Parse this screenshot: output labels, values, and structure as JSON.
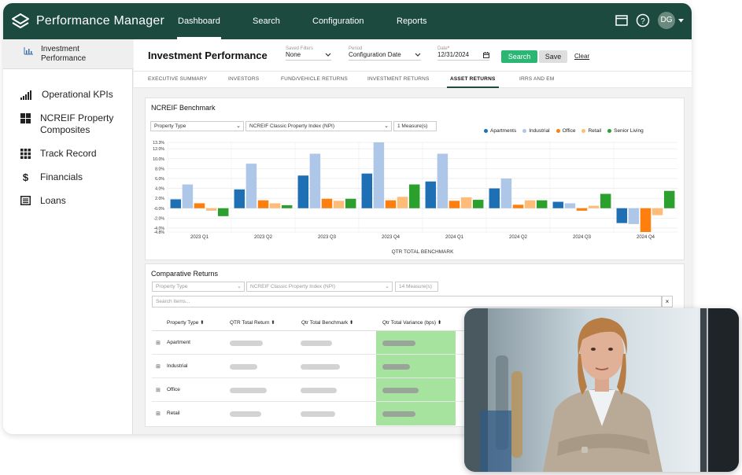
{
  "app": {
    "brand": "Performance Manager",
    "avatar_initials": "DG"
  },
  "nav": [
    "Dashboard",
    "Search",
    "Configuration",
    "Reports"
  ],
  "sidebar": {
    "active": "Investment Performance",
    "items": [
      "Operational KPIs",
      "NCREIF Property Composites",
      "Track Record",
      "Financials",
      "Loans"
    ]
  },
  "header": {
    "title": "Investment Performance",
    "saved_filters_caption": "Saved Filters",
    "saved_filters_value": "None",
    "period_caption": "Period",
    "period_value": "Configuration Date",
    "date_caption": "Date",
    "date_value": "12/31/2024",
    "search_label": "Search",
    "save_label": "Save",
    "clear_label": "Clear"
  },
  "tabs": [
    "EXECUTIVE SUMMARY",
    "INVESTORS",
    "FUND/VEHICLE RETURNS",
    "INVESTMENT RETURNS",
    "ASSET RETURNS",
    "IRRS AND EM"
  ],
  "benchmark": {
    "title": "NCREIF Benchmark",
    "filter_property": "Property Type",
    "filter_index": "NCREIF Classic Property Index (NPI)",
    "filter_measures": "1 Measure(s)"
  },
  "comparative": {
    "title": "Comparative Returns",
    "filter_property": "Property Type",
    "filter_index": "NCREIF Classic Property Index (NPI)",
    "filter_measures": "14 Measure(s)",
    "search_placeholder": "Search items...",
    "clear_icon": "×",
    "columns": [
      "Property Type ⬍",
      "QTR Total Return ⬍",
      "Qtr Total Benchmark ⬍",
      "Qtr Total Variance (bps) ⬍"
    ],
    "rows": [
      "Apartment",
      "Industrial",
      "Office",
      "Retail"
    ]
  },
  "chart_data": {
    "type": "bar",
    "title": "",
    "xlabel": "QTR TOTAL BENCHMARK",
    "ylabel": "",
    "ylim": [
      -4.8,
      13.3
    ],
    "yticks": [
      "13.3%",
      "12.0%",
      "10.0%",
      "8.0%",
      "6.0%",
      "4.0%",
      "2.0%",
      "-0.0%",
      "-2.0%",
      "-4.0%",
      "-4.8%"
    ],
    "ytick_values": [
      13.3,
      12.0,
      10.0,
      8.0,
      6.0,
      4.0,
      2.0,
      0.0,
      -2.0,
      -4.0,
      -4.8
    ],
    "grid": true,
    "legend_position": "top-right",
    "categories": [
      "2023 Q1",
      "2023 Q2",
      "2023 Q3",
      "2023 Q4",
      "2024 Q1",
      "2024 Q2",
      "2024 Q3",
      "2024 Q4"
    ],
    "series": [
      {
        "name": "Apartments",
        "color": "#1f6fb4",
        "values": [
          1.8,
          3.8,
          6.6,
          7.0,
          5.4,
          4.0,
          1.3,
          -3.0
        ]
      },
      {
        "name": "Industrial",
        "color": "#aec7e8",
        "values": [
          4.8,
          9.0,
          11.0,
          13.3,
          11.0,
          6.0,
          1.0,
          -3.2
        ]
      },
      {
        "name": "Office",
        "color": "#ff7f0e",
        "values": [
          1.0,
          1.6,
          1.9,
          1.6,
          1.5,
          0.7,
          -0.5,
          -4.8
        ]
      },
      {
        "name": "Retail",
        "color": "#ffbb78",
        "values": [
          -0.5,
          1.0,
          1.5,
          2.3,
          2.2,
          1.6,
          0.5,
          -1.4
        ]
      },
      {
        "name": "Senior Living",
        "color": "#2ca02c",
        "values": [
          -1.6,
          0.6,
          1.9,
          4.8,
          1.7,
          1.6,
          2.9,
          3.5
        ]
      }
    ]
  }
}
